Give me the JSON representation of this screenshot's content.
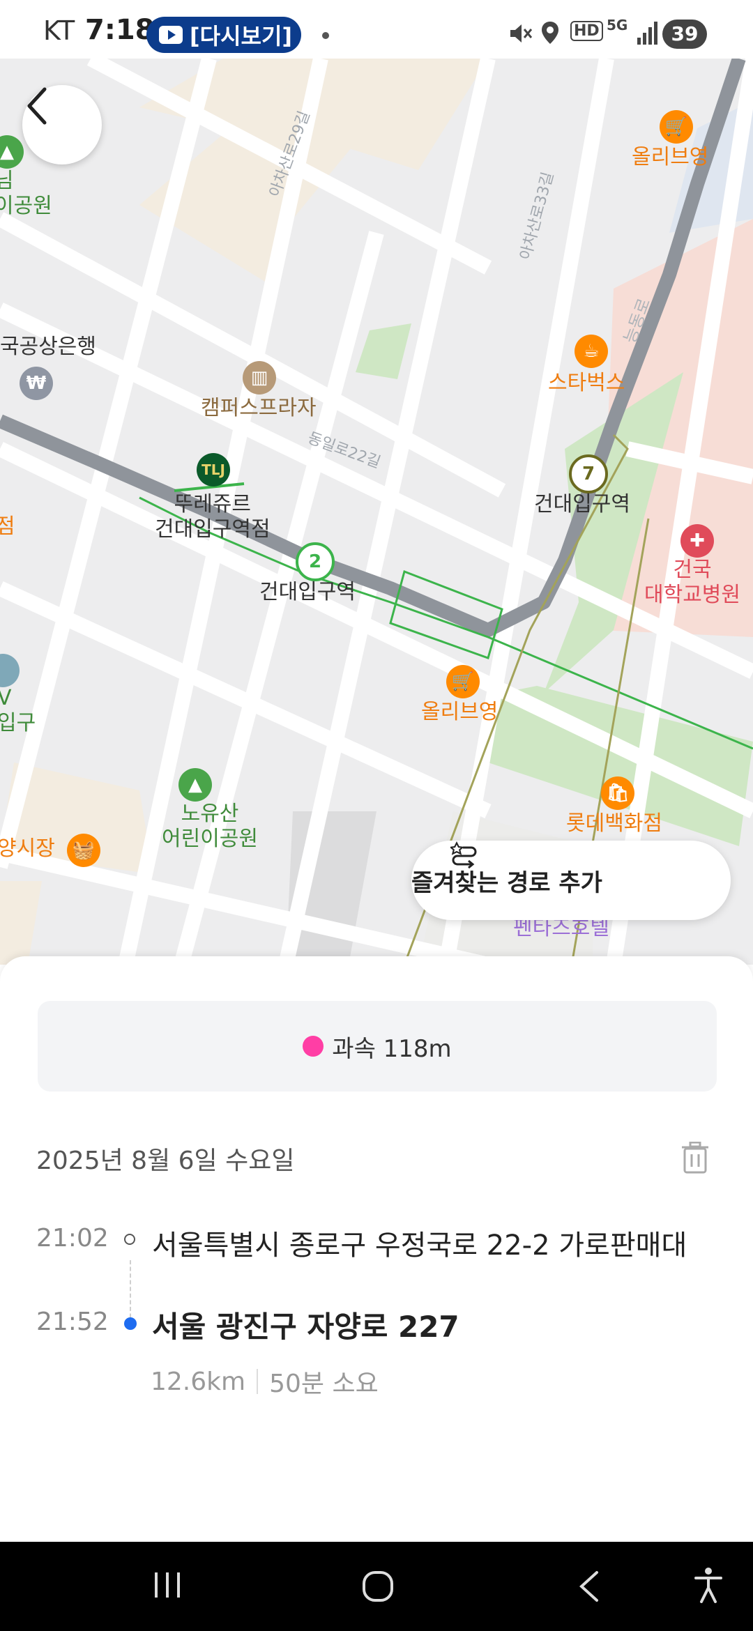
{
  "status_bar": {
    "carrier": "KT",
    "time": "7:18",
    "pill_text": "[다시보기]",
    "battery": "39",
    "network": "5G",
    "hd": "HD"
  },
  "map": {
    "places": {
      "olive_young_top": "올리브영",
      "park_left": "님\n이공원",
      "bank": "국공상은행",
      "campus_plaza": "캠퍼스프라자",
      "starbucks": "스타벅스",
      "station_line7": "건대입구역",
      "tous_les_jours": "뚜레쥬르\n건대입구역점",
      "station_line2": "건대입구역",
      "hospital": "건국\n대학교병원",
      "olive_young_bottom": "올리브영",
      "left_edge_1": "점",
      "left_edge_2": "V\n입구",
      "nouyusan_park": "노유산\n어린이공원",
      "lotte": "롯데백화점",
      "market": "양시장",
      "pentaz_hotel": "펜타즈호텔"
    },
    "roads": {
      "road_29": "아차산로29길",
      "road_33": "아차산로33길",
      "dongil": "동일로22길",
      "neungdong": "능동로"
    },
    "station_numbers": {
      "line7": "7",
      "line2": "2"
    },
    "tous_les_jours_badge": "TLJ",
    "favorite_route_label": "즐겨찾는 경로 추가"
  },
  "sheet": {
    "speed_label": "과속 118m",
    "date": "2025년 8월 6일 수요일",
    "start": {
      "time": "21:02",
      "address": "서울특별시 종로구 우정국로 22-2 가로판매대"
    },
    "end": {
      "time": "21:52",
      "address": "서울 광진구 자양로 227"
    },
    "distance": "12.6km",
    "duration": "50분 소요"
  },
  "colors": {
    "route": "#8f949b",
    "speed_dot": "#ff3ea5",
    "end_dot": "#1e6cf0",
    "line2": "#3cb44b",
    "line7": "#6b6a1f"
  }
}
